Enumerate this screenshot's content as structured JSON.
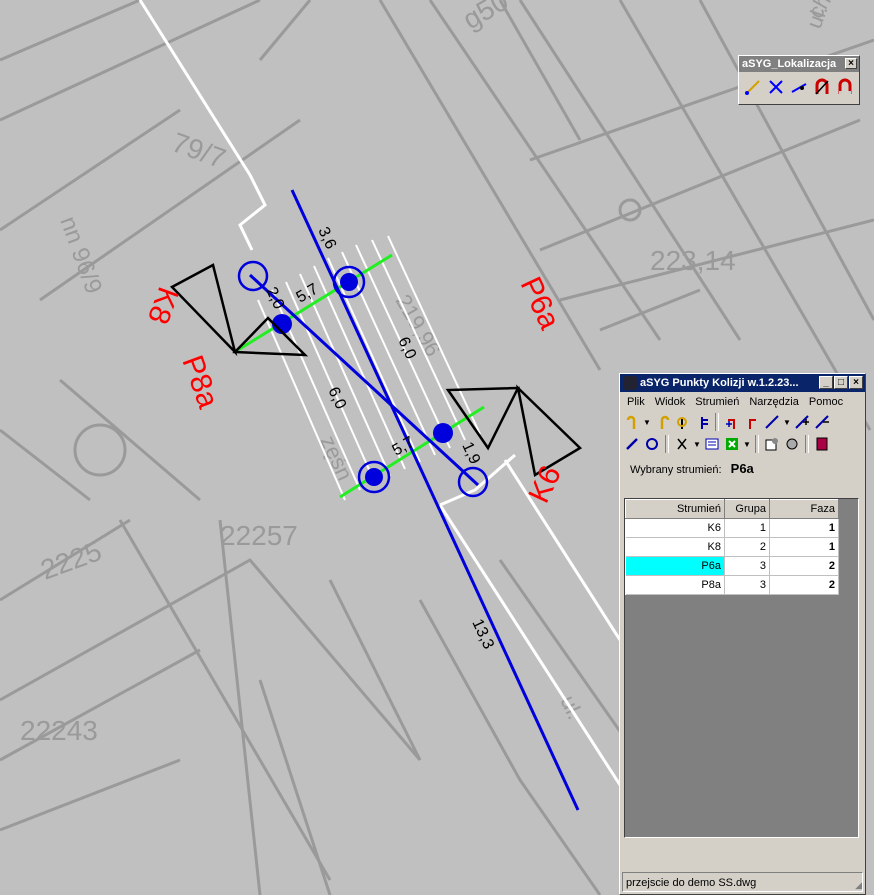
{
  "map": {
    "parcel_labels": [
      "79/7",
      "ul. Św. Ch",
      "2225",
      "22243",
      "22257",
      "223,14",
      "219,96",
      "g50",
      "nn 96/9",
      "zęśn",
      "ch",
      "ul. "
    ],
    "segment_labels": [
      "3,6",
      "2,0",
      "5,7",
      "6,0",
      "6,0",
      "5,7",
      "1,9",
      "13,3"
    ],
    "stream_labels": [
      "K8",
      "P8a",
      "P6a",
      "K6"
    ],
    "colors": {
      "background": "#c0c0c0",
      "map_lines": "#9a9a9a",
      "boundary": "#ffffff",
      "stream": "#0000dd",
      "crossing": "#22ee22",
      "label": "#ff0000",
      "arrow": "#000000"
    }
  },
  "loc_toolbar": {
    "title": "aSYG_Lokalizacja",
    "close": "×",
    "icons": [
      "line-locate-icon",
      "cross-locate-icon",
      "segment-locate-icon",
      "magnet-red-icon",
      "magnet-icon"
    ]
  },
  "main_window": {
    "title": "aSYG Punkty Kolizji w.1.2.23...",
    "controls": [
      "_",
      "□",
      "×"
    ],
    "menu": [
      "Plik",
      "Widok",
      "Strumień",
      "Narzędzia",
      "Pomoc"
    ],
    "selected_label": "Wybrany strumień:",
    "selected_value": "P6a",
    "columns": [
      "Strumień",
      "Grupa",
      "Faza"
    ],
    "rows": [
      {
        "strumien": "K6",
        "grupa": "1",
        "faza": "1"
      },
      {
        "strumien": "K8",
        "grupa": "2",
        "faza": "1"
      },
      {
        "strumien": "P6a",
        "grupa": "3",
        "faza": "2"
      },
      {
        "strumien": "P8a",
        "grupa": "3",
        "faza": "2"
      }
    ],
    "status": "przejscie  do demo SS.dwg",
    "highlight_color": "#00ffff"
  }
}
